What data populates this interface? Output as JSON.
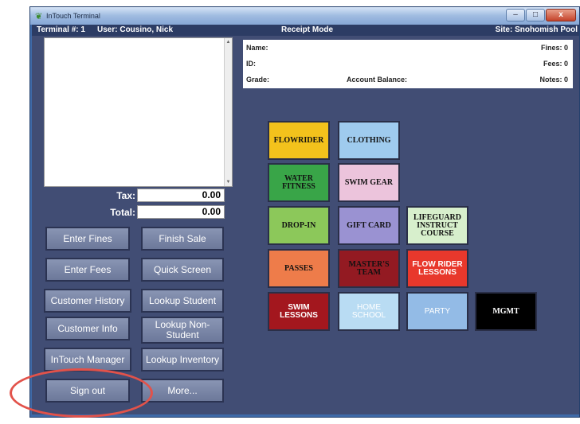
{
  "window": {
    "title": "InTouch Terminal",
    "app_icon": "leaf-icon",
    "minimize_glyph": "–",
    "maximize_glyph": "□",
    "close_glyph": "x"
  },
  "infobar": {
    "terminal": "Terminal #: 1",
    "user": "User: Cousino, Nick",
    "mode": "Receipt Mode",
    "site": "Site: Snohomish Pool"
  },
  "receipt": {
    "scroll_up": "▲",
    "scroll_down": "▼"
  },
  "totals": {
    "tax_label": "Tax:",
    "tax_value": "0.00",
    "total_label": "Total:",
    "total_value": "0.00"
  },
  "customer": {
    "name_label": "Name:",
    "id_label": "ID:",
    "grade_label": "Grade:",
    "balance_label": "Account Balance:",
    "fines": "Fines: 0",
    "fees": "Fees: 0",
    "notes": "Notes: 0"
  },
  "buttons": {
    "enter_fines": "Enter Fines",
    "finish_sale": "Finish Sale",
    "enter_fees": "Enter Fees",
    "quick_screen": "Quick Screen",
    "customer_history": "Customer History",
    "lookup_student": "Lookup Student",
    "customer_info": "Customer Info",
    "lookup_non_student": "Lookup Non-Student",
    "intouch_manager": "InTouch Manager",
    "lookup_inventory": "Lookup Inventory",
    "sign_out": "Sign out",
    "more": "More..."
  },
  "categories": {
    "flowrider": "FLOWRIDER",
    "clothing": "CLOTHING",
    "water_fitness": "WATER FITNESS",
    "swim_gear": "SWIM GEAR",
    "drop_in": "DROP-IN",
    "gift_card": "GIFT CARD",
    "lifeguard": "LIFEGUARD INSTRUCT COURSE",
    "passes": "PASSES",
    "masters_team": "MASTER'S TEAM",
    "flow_rider_lessons": "FLOW RIDER LESSONS",
    "swim_lessons": "SWIM LESSONS",
    "home_school": "HOME SCHOOL",
    "party": "PARTY",
    "mgmt": "MGMT"
  },
  "colors": {
    "highlight_ring": "#e2524a",
    "background": "#414d74"
  }
}
